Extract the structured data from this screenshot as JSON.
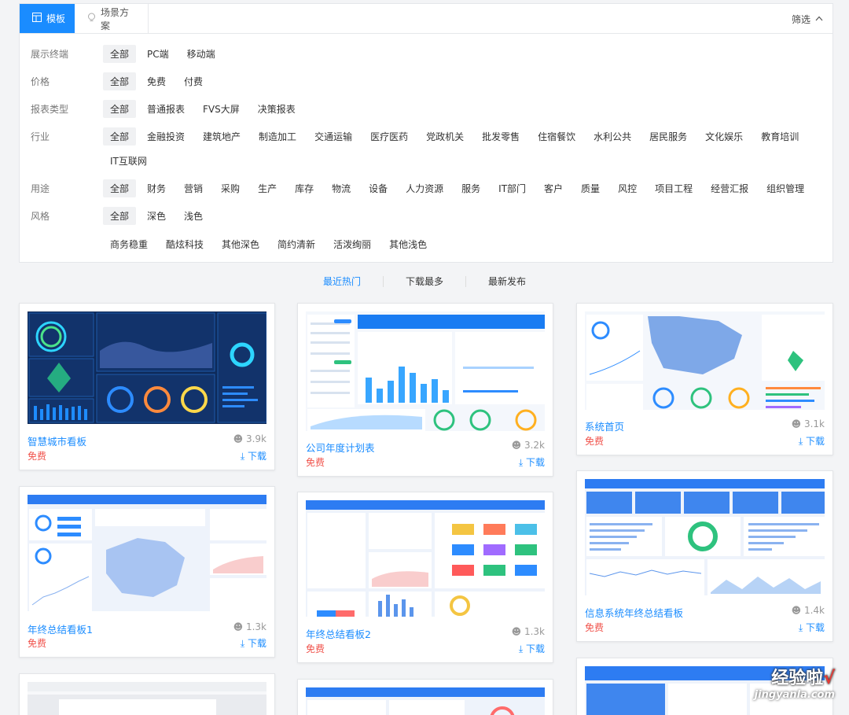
{
  "tabs": [
    {
      "label": "模板"
    },
    {
      "label": "场景方案"
    }
  ],
  "filter_toggle": "筛选",
  "filters": [
    {
      "label": "展示终端",
      "options": [
        "全部",
        "PC端",
        "移动端"
      ]
    },
    {
      "label": "价格",
      "options": [
        "全部",
        "免费",
        "付费"
      ]
    },
    {
      "label": "报表类型",
      "options": [
        "全部",
        "普通报表",
        "FVS大屏",
        "决策报表"
      ]
    },
    {
      "label": "行业",
      "options": [
        "全部",
        "金融投资",
        "建筑地产",
        "制造加工",
        "交通运输",
        "医疗医药",
        "党政机关",
        "批发零售",
        "住宿餐饮",
        "水利公共",
        "居民服务",
        "文化娱乐",
        "教育培训"
      ],
      "options2": [
        "IT互联网"
      ]
    },
    {
      "label": "用途",
      "options": [
        "全部",
        "财务",
        "营销",
        "采购",
        "生产",
        "库存",
        "物流",
        "设备",
        "人力资源",
        "服务",
        "IT部门",
        "客户",
        "质量",
        "风控",
        "项目工程",
        "经营汇报",
        "组织管理"
      ]
    },
    {
      "label": "风格",
      "options": [
        "全部",
        "深色",
        "浅色"
      ],
      "options2": [
        "商务稳重",
        "酷炫科技",
        "其他深色",
        "简约清新",
        "活泼绚丽",
        "其他浅色"
      ]
    }
  ],
  "sort": [
    "最近热门",
    "下载最多",
    "最新发布"
  ],
  "cards": [
    {
      "title": "智慧城市看板",
      "price": "免费",
      "count": "3.9k",
      "download": "下载"
    },
    {
      "title": "公司年度计划表",
      "price": "免费",
      "count": "3.2k",
      "download": "下载"
    },
    {
      "title": "系统首页",
      "price": "免费",
      "count": "3.1k",
      "download": "下载"
    },
    {
      "title": "年终总结看板1",
      "price": "免费",
      "count": "1.3k",
      "download": "下载"
    },
    {
      "title": "年终总结看板2",
      "price": "免费",
      "count": "1.3k",
      "download": "下载"
    },
    {
      "title": "信息系统年终总结看板",
      "price": "免费",
      "count": "1.4k",
      "download": "下载"
    }
  ],
  "watermark": {
    "line1": "经验啦",
    "check": "√",
    "line2": "jingyanla.com"
  },
  "colors": {
    "accent": "#1a8cff",
    "price": "#f0524b",
    "dark_bg": "#0e2a5a"
  }
}
